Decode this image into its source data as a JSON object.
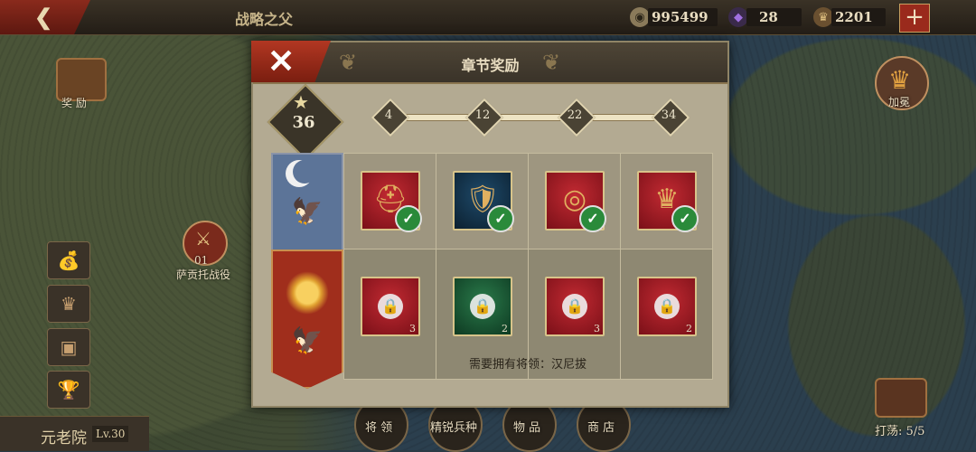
{
  "top_bar": {
    "title": "战略之父",
    "gold": "995499",
    "gems": "28",
    "medals": "2201",
    "add_label": "+"
  },
  "map": {
    "rewards_label": "奖 励",
    "battle_label": "萨贡托战役",
    "battle_number": "01",
    "coronation_label": "加冕",
    "sweep_label": "打荡: 5/5",
    "senate_label": "元老院",
    "level_label": "Lv.30",
    "bottom_nav": [
      "将 领",
      "精锐兵种",
      "物 品",
      "商 店"
    ]
  },
  "dialog": {
    "title": "章节奖励",
    "star_total": "36",
    "milestones": [
      "4",
      "12",
      "22",
      "34"
    ],
    "claimed_row": [
      {
        "name": "helmet",
        "icon": "helmet-icon",
        "claimed": true
      },
      {
        "name": "shield",
        "icon": "shield-icon",
        "claimed": true
      },
      {
        "name": "ring",
        "icon": "ring-icon",
        "claimed": true
      },
      {
        "name": "crown",
        "icon": "crown-icon",
        "claimed": true
      }
    ],
    "locked_row": [
      {
        "name": "helmet",
        "icon": "helmet-icon",
        "qty": "3"
      },
      {
        "name": "armor",
        "icon": "armor-icon",
        "qty": "2"
      },
      {
        "name": "ring",
        "icon": "ring-icon",
        "qty": "3"
      },
      {
        "name": "crown",
        "icon": "crown-icon",
        "qty": "2"
      }
    ],
    "requirement_text": "需要拥有将领：汉尼拔"
  },
  "colors": {
    "accent_red": "#a02e1c",
    "claimed_green": "#2a8a3a",
    "banner_blue": "#5c7498"
  }
}
